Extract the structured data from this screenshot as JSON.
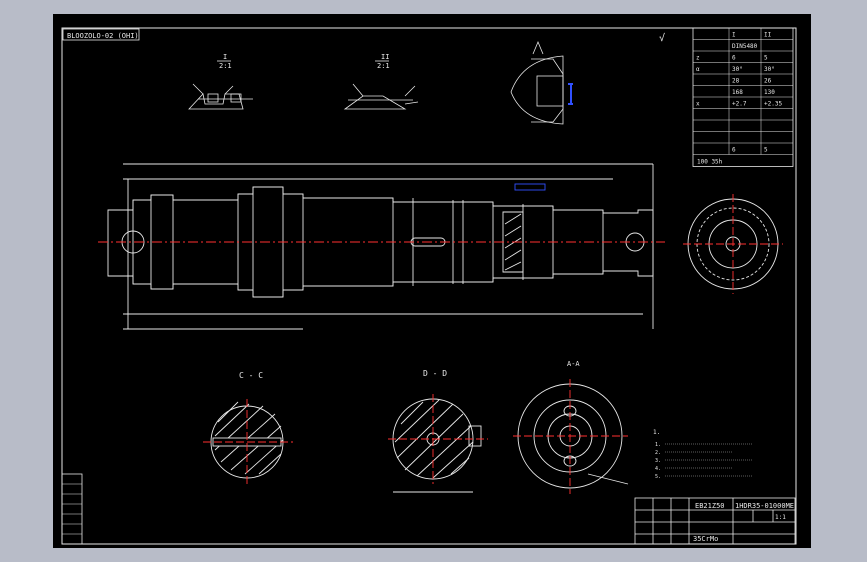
{
  "drawing": {
    "code_box": "BLOOZOLO-02 (OHI)",
    "roughness_top_right": "√",
    "title_block_code": "1HDR35-01000ME",
    "title_block_name": "EB21Z50",
    "title_block_material": "35CrMo",
    "ratio": "1:1"
  },
  "sections": {
    "cc": "C - C",
    "dd": "D - D",
    "aa": "A-A",
    "small_1": "I",
    "small_1_scale": "2:1",
    "small_2": "II",
    "small_2_scale": "2:1"
  },
  "gear_table": {
    "rows": [
      [
        "",
        "I",
        "II"
      ],
      [
        "",
        "DIN5480",
        ""
      ],
      [
        "z",
        "6",
        "5"
      ],
      [
        "α",
        "30°",
        "30°"
      ],
      [
        "",
        "28",
        "26"
      ],
      [
        "",
        "168",
        "130"
      ],
      [
        "x",
        "+2.7",
        "+2.35"
      ],
      [
        "",
        "",
        ""
      ],
      [
        "",
        "",
        ""
      ],
      [
        "",
        "",
        ""
      ],
      [
        "",
        "6",
        "5"
      ]
    ],
    "footer": "100 35h"
  },
  "notes": {
    "heading": "1.",
    "lines": [
      "1.",
      "2.",
      "3.",
      "4.",
      "5."
    ]
  },
  "left_strip": {
    "cells": [
      "",
      "",
      "",
      "",
      "",
      "",
      ""
    ]
  },
  "colors": {
    "line": "#e8e8e8",
    "center": "#ff3030",
    "accent": "#3050ff",
    "background": "#000000",
    "frame": "#b8bcc8"
  }
}
